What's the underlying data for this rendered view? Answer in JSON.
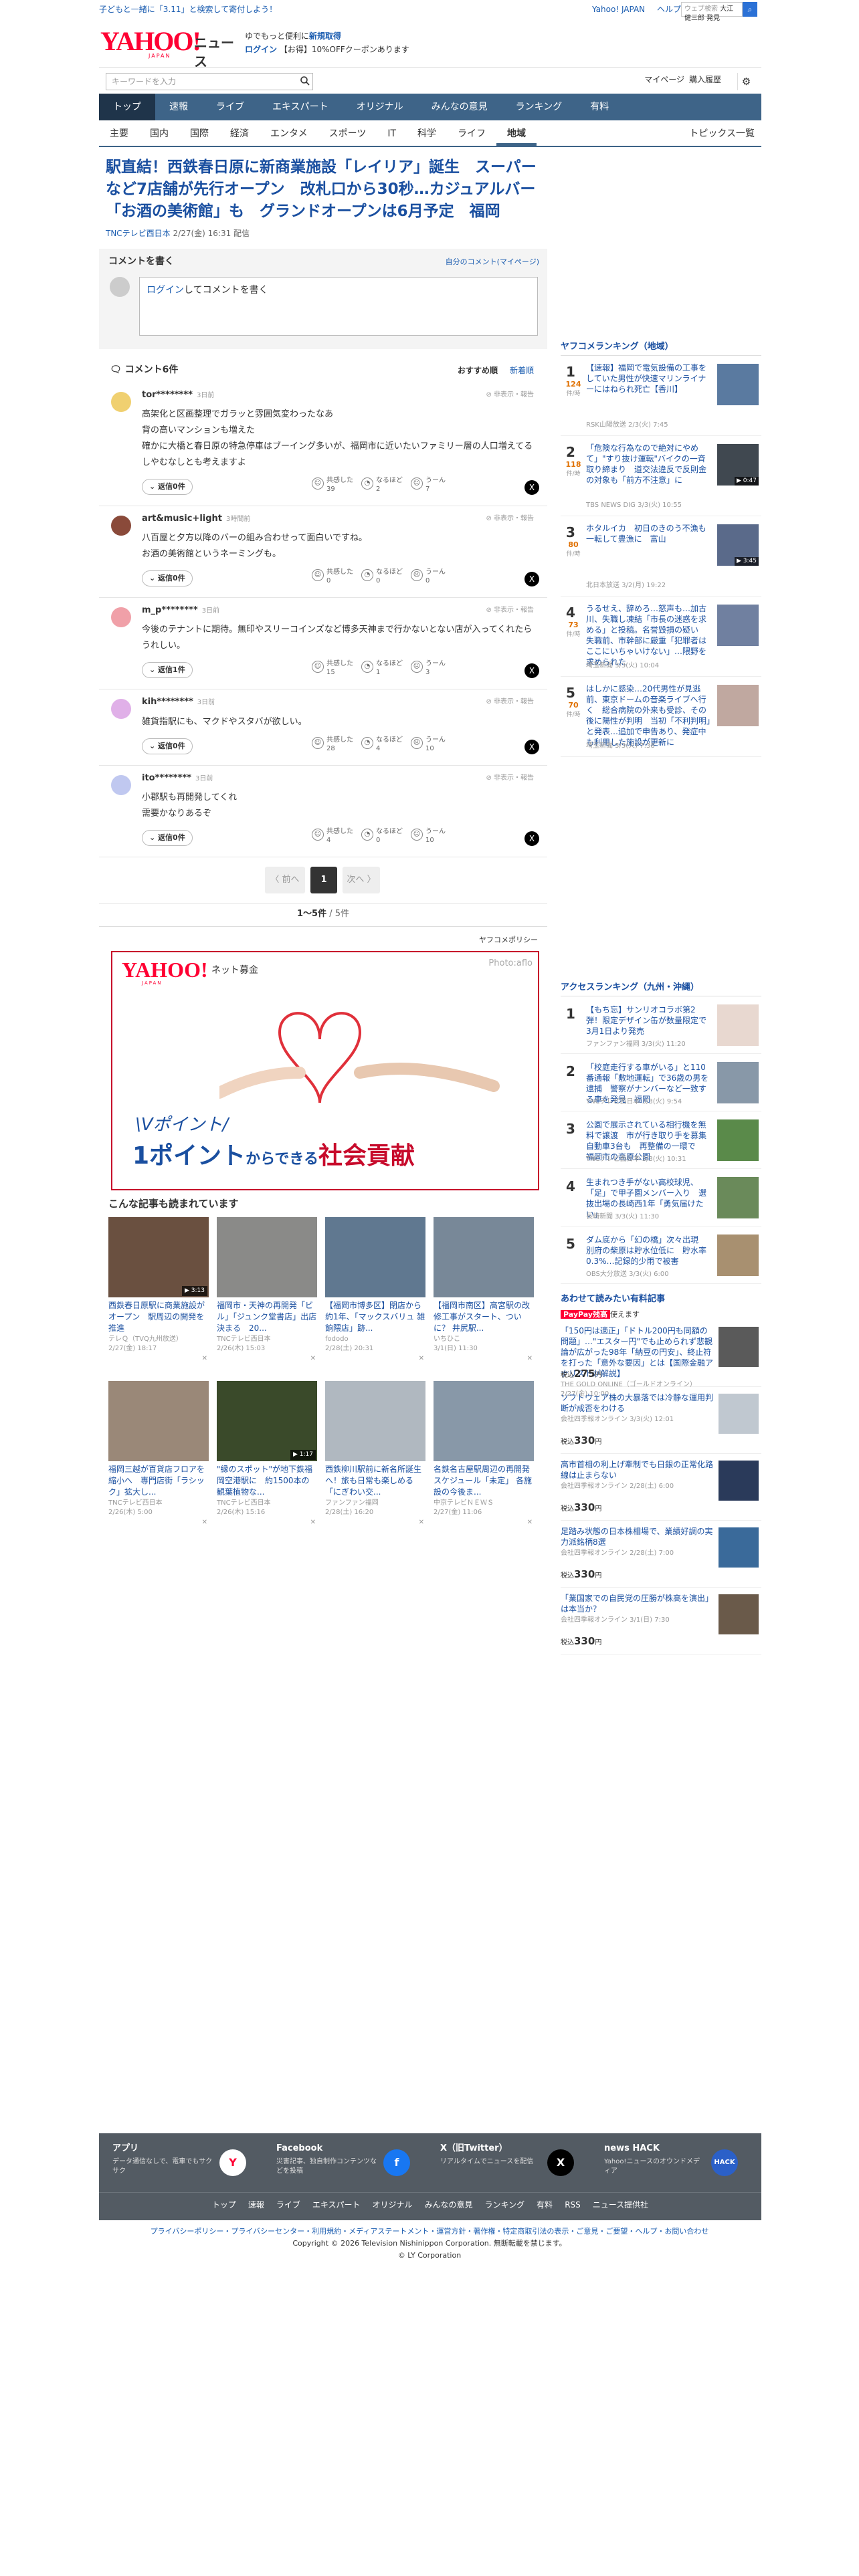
{
  "topbar": {
    "promo": "子どもと一緒に「3.11」と検索して寄付しよう！",
    "links": [
      "Yahoo! JAPAN",
      "ヘルプ"
    ],
    "search_placeholder": "ウェブ検索",
    "search_prefill": "大江健三郎 発見"
  },
  "header": {
    "logo_text": "YAHOO!",
    "logo_sub": "JAPAN",
    "logo_news": "ニュース",
    "promo_line1": "ゆでもっと便利に",
    "promo_line1_link": "新規取得",
    "promo_line2_login": "ログイン",
    "promo_line2_rest": "【お得】10%OFFクーポンあります"
  },
  "subbar": {
    "keyword_placeholder": "キーワードを入力",
    "mypage": "マイページ",
    "history": "購入履歴"
  },
  "mainnav": [
    "トップ",
    "速報",
    "ライブ",
    "エキスパート",
    "オリジナル",
    "みんなの意見",
    "ランキング",
    "有料"
  ],
  "subnav": [
    "主要",
    "国内",
    "国際",
    "経済",
    "エンタメ",
    "スポーツ",
    "IT",
    "科学",
    "ライフ",
    "地域"
  ],
  "subnav_right": "トピックス一覧",
  "article": {
    "title": "駅直結！西鉄春日原に新商業施設「レイリア」誕生　スーパーなど7店舗が先行オープン　改札口から30秒…カジュアルバー「お酒の美術館」も　グランドオープンは6月予定　福岡",
    "source": "TNCテレビ西日本",
    "date": "2/27(金) 16:31 配信"
  },
  "comment_write": {
    "heading": "コメントを書く",
    "mine": "自分のコメント(マイページ)",
    "login": "ログイン",
    "prompt": "してコメントを書く"
  },
  "comments_header": {
    "title": "コメント6件",
    "sort_recommended": "おすすめ順",
    "sort_new": "新着順"
  },
  "comments": [
    {
      "name": "tor********",
      "time": "3日前",
      "report": "非表示・報告",
      "text": [
        "高架化と区画整理でガラッと雰囲気変わったなあ",
        "背の高いマンションも増えた",
        "確かに大橋と春日原の特急停車はブーイング多いが、福岡市に近いたいファミリー層の人口増えてるしやむなしとも考えますよ"
      ],
      "reply": "返信0件",
      "empathy": [
        "共感した",
        "39"
      ],
      "insight": [
        "なるほど",
        "2"
      ],
      "hmm": [
        "うーん",
        "7"
      ],
      "color": "#f0d070"
    },
    {
      "name": "art&music+light",
      "time": "3時間前",
      "report": "非表示・報告",
      "text": [
        "八百屋と夕方以降のバーの組み合わせって面白いですね。",
        "お酒の美術館というネーミングも。"
      ],
      "reply": "返信0件",
      "empathy": [
        "共感した",
        "0"
      ],
      "insight": [
        "なるほど",
        "0"
      ],
      "hmm": [
        "うーん",
        "0"
      ],
      "color": "#8a4a3a"
    },
    {
      "name": "m_p********",
      "time": "3日前",
      "report": "非表示・報告",
      "text": [
        "今後のテナントに期待。無印やスリーコインズなど博多天神まで行かないとない店が入ってくれたらうれしい。"
      ],
      "reply": "返信1件",
      "empathy": [
        "共感した",
        "15"
      ],
      "insight": [
        "なるほど",
        "1"
      ],
      "hmm": [
        "うーん",
        "3"
      ],
      "color": "#f0a0a8"
    },
    {
      "name": "kih********",
      "time": "3日前",
      "report": "非表示・報告",
      "text": [
        "雑貨指駅にも、マクドやスタバが欲しい。"
      ],
      "reply": "返信0件",
      "empathy": [
        "共感した",
        "28"
      ],
      "insight": [
        "なるほど",
        "4"
      ],
      "hmm": [
        "うーん",
        "10"
      ],
      "color": "#e0b0e8"
    },
    {
      "name": "ito********",
      "time": "3日前",
      "report": "非表示・報告",
      "text": [
        "小郡駅も再開発してくれ",
        "需要かなりあるぞ"
      ],
      "reply": "返信0件",
      "empathy": [
        "共感した",
        "4"
      ],
      "insight": [
        "なるほど",
        "0"
      ],
      "hmm": [
        "うーん",
        "10"
      ],
      "color": "#c0c8f0"
    }
  ],
  "pager": {
    "prev": "〈 前へ",
    "page": "1",
    "next": "次へ 〉",
    "count_bold": "1〜5件",
    "count_rest": "/ 5件"
  },
  "memory": "ヤフコメポリシー",
  "ad": {
    "logo": "YAHOO!",
    "logo_sub": "JAPAN",
    "brand": "ネット募金",
    "photo_credit": "Photo:aflo",
    "vpoint": "\\Vポイント/",
    "big_num": "1ポイント",
    "big_mid": "からできる",
    "big_end": "社会貢献",
    "heart_color": "#e0303a"
  },
  "related": {
    "heading": "こんな記事も読まれています",
    "items": [
      {
        "title": "西鉄春日原駅に商業施設がオープン　駅周辺の開発を推進",
        "source": "テレＱ（TVQ九州放送）",
        "date": "2/27(金) 18:17",
        "duration": "▶ 3:13",
        "tone": "#6a5040"
      },
      {
        "title": "福岡市・天神の再開発「ビル」「ジュンク堂書店」出店決まる　20...",
        "source": "TNCテレビ西日本",
        "date": "2/26(木) 15:03",
        "duration": "",
        "tone": "#8a8a88"
      },
      {
        "title": "【福岡市博多区】閉店から約1年、「マックスバリュ 雑餉隈店」跡...",
        "source": "fododo",
        "date": "2/28(土) 20:31",
        "duration": "",
        "tone": "#607890"
      },
      {
        "title": "【福岡市南区】高宮駅の改修工事がスタート、ついに？ 井尻駅...",
        "source": "いちひこ",
        "date": "3/1(日) 11:30",
        "duration": "",
        "tone": "#788898"
      },
      {
        "title": "福岡三越が百貨店フロアを縮小へ　専門店街「ラシック」拡大し...",
        "source": "TNCテレビ西日本",
        "date": "2/26(木) 5:00",
        "duration": "",
        "tone": "#9a8878"
      },
      {
        "title": "\"縁のスポット\"が地下鉄福岡空港駅に　約1500本の観葉植物な...",
        "source": "TNCテレビ西日本",
        "date": "2/26(木) 15:16",
        "duration": "▶ 1:17",
        "tone": "#3a4a2a"
      },
      {
        "title": "西鉄柳川駅前に新名所誕生へ！旅も日常も楽しめる「にぎわい交...",
        "source": "ファンファン福岡",
        "date": "2/28(土) 16:20",
        "duration": "",
        "tone": "#b0b8c0"
      },
      {
        "title": "名鉄名古屋駅周辺の再開発スケジュール「未定」 各施設の今後ま...",
        "source": "中京テレビＮＥＷＳ",
        "date": "2/27(金) 11:06",
        "duration": "",
        "tone": "#8898a8"
      }
    ]
  },
  "ranking": {
    "heading": "ヤフコメランキング（地域）",
    "items": [
      {
        "rank": "1",
        "count": "124",
        "unit": "件/時",
        "title": "【速報】福岡で電気設備の工事をしていた男性が快速マリンライナーにはねられ死亡【香川】",
        "source": "RSK山陽放送 2/3(火) 7:45",
        "tone": "#5a7aa0",
        "duration": ""
      },
      {
        "rank": "2",
        "count": "118",
        "unit": "件/時",
        "title": "「危険な行為なので絶対にやめて」\"すり抜け運転\"バイクの一斉取り締まり　道交法違反で反則金の対象も「前方不注意」に",
        "source": "TBS NEWS DIG 3/3(火) 10:55",
        "tone": "#404850",
        "duration": "▶ 0:47"
      },
      {
        "rank": "3",
        "count": "80",
        "unit": "件/時",
        "title": "ホタルイカ　初日のきのう不漁も　一転して豊漁に　富山",
        "source": "北日本放送 3/2(月) 19:22",
        "tone": "#5a6a8a",
        "duration": "▶ 3:45"
      },
      {
        "rank": "4",
        "count": "73",
        "unit": "件/時",
        "title": "うるせえ、辞めろ…怒声も…加古川、失職し凍結「市長の迷惑を求める」と投稿。名誉毀損の疑い　失職前、市幹部に厳重「犯罪者はここにいちゃいけない」…隈野を求められた",
        "source": "埼玉新聞 3/3(火) 10:04",
        "tone": "#7080a0",
        "duration": ""
      },
      {
        "rank": "5",
        "count": "70",
        "unit": "件/時",
        "title": "はしかに感染…20代男性が見逃前、東京ドームの音楽ライブへ行く　総合病院の外来も受診、その後に陽性が判明　当初「不利判明」と発表…追加で申告あり、発症中も利用した施設が更新に",
        "source": "埼玉新聞 3/3(火) 7:38",
        "tone": "#c0a8a0",
        "duration": ""
      }
    ]
  },
  "access": {
    "heading": "アクセスランキング（九州・沖縄）",
    "items": [
      {
        "rank": "1",
        "title": "【もち忘】サンリオコラボ第2弾！限定デザイン缶が数量限定で3月1日より発売",
        "source": "ファンファン福岡 3/3(火) 11:20",
        "tone": "#e8d8d0"
      },
      {
        "rank": "2",
        "title": "「校庭走行する車がいる」と110番通報「敷地運転」で36歳の男を逮捕　警察がナンバーなど一致する車を発見　福岡",
        "source": "TNCテレビ西日本 3/3(火) 9:54",
        "tone": "#8898a8"
      },
      {
        "rank": "3",
        "title": "公園で展示されている相行機を無料で譲渡　市が行き取り手を募集　自動車3台も　再整備の一環で　福岡市の高原公園",
        "source": "TNCテレビ西日本 3/3(火) 10:31",
        "tone": "#5a8a4a"
      },
      {
        "rank": "4",
        "title": "生まれつき手がない高校球児、「足」で甲子園メンバー入り　選抜出場の長崎西1年「勇気届けたい」",
        "source": "長崎新聞 3/3(火) 11:30",
        "tone": "#6a8a5a"
      },
      {
        "rank": "5",
        "title": "ダム底から「幻の橋」次々出現　別府の柴原は貯水位低に　貯水率0.3%…記録的少雨で被害",
        "source": "OBS大分放送 3/3(火) 6:00",
        "tone": "#a89070"
      }
    ]
  },
  "paid": {
    "heading": "あわせて読みたい有料記事",
    "paypay": "PayPay残高",
    "paypay_rest": "使えます",
    "tax_label": "税込",
    "yen": "円",
    "items": [
      {
        "title": "「150円は適正」「ドトル200円も同額の問題」…\"エスター円\"でも止められず悲観論が広がった98年「納豆の円安」、終止符を打った「意外な要因」とは【国際金融アナリストが解説】",
        "source": "THE GOLD ONLINE（ゴールドオンライン） 2/27(金) 10:00",
        "price": "275",
        "tone": "#5a5a5a"
      },
      {
        "title": "ソフトウェア株の大暴落では冷静な運用判断が成否をわける",
        "source": "会社四季報オンライン 3/3(火) 12:01",
        "price": "330",
        "tone": "#c0c8d0"
      },
      {
        "title": "高市首相の利上げ牽制でも日銀の正常化路線は止まらない",
        "source": "会社四季報オンライン 2/28(土) 6:00",
        "price": "330",
        "tone": "#2a3a5a"
      },
      {
        "title": "足踏み状態の日本株相場で、業績好調の実力派銘柄8選",
        "source": "会社四季報オンライン 2/28(土) 7:00",
        "price": "330",
        "tone": "#3a6a9a"
      },
      {
        "title": "「業国家での自民党の圧勝が株高を演出」は本当か？",
        "source": "会社四季報オンライン 3/1(日) 7:30",
        "price": "330",
        "tone": "#6a5a4a"
      }
    ]
  },
  "footer": {
    "apps": [
      {
        "name": "アプリ",
        "desc": "データ通信なしで、電車でもサクサク",
        "icon": "Y",
        "color": "#ffffff",
        "fg": "#ff0033"
      },
      {
        "name": "Facebook",
        "desc": "災害記事、独自制作コンテンツなどを投稿",
        "icon": "f",
        "color": "#1877f2",
        "fg": "#ffffff"
      },
      {
        "name": "X（旧Twitter）",
        "desc": "リアルタイムでニュースを配信",
        "icon": "X",
        "color": "#000000",
        "fg": "#ffffff"
      },
      {
        "name": "news HACK",
        "desc": "Yahoo!ニュースのオウンドメディア",
        "icon": "HACK",
        "color": "#2b60c8",
        "fg": "#ffffff"
      }
    ],
    "links": [
      "トップ",
      "速報",
      "ライブ",
      "エキスパート",
      "オリジナル",
      "みんなの意見",
      "ランキング",
      "有料",
      "RSS",
      "ニュース提供社"
    ],
    "legal": "プライバシーポリシー・プライバシーセンター・利用規約・メディアステートメント・運営方針・著作権・特定商取引法の表示・ご意見・ご要望・ヘルプ・お問い合わせ",
    "copyright": "Copyright © 2026 Television Nishinippon Corporation. 無断転載を禁じます。",
    "corp": "© LY Corporation"
  }
}
